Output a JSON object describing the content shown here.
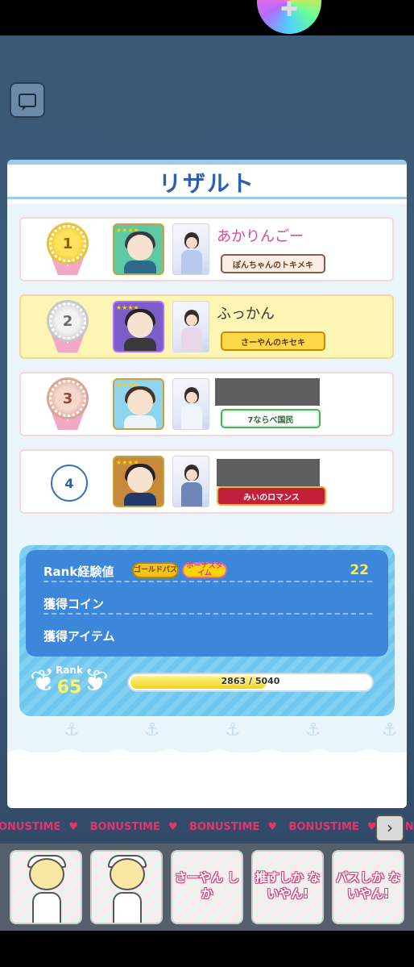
{
  "modal": {
    "title": "リザルト"
  },
  "results": [
    {
      "rank": "1",
      "name": "あかりんごー",
      "badge": "ぽんちゃんのトキメキ",
      "name_hidden": false
    },
    {
      "rank": "2",
      "name": "ふっかん",
      "badge": "さーやんのキセキ",
      "name_hidden": false
    },
    {
      "rank": "3",
      "name": "",
      "badge": "7ならべ国民",
      "name_hidden": true
    },
    {
      "rank": "4",
      "name": "",
      "badge": "みいのロマンス",
      "name_hidden": true
    }
  ],
  "rewards": {
    "rank_exp_label": "Rank経験値",
    "gold_pass_label": "ゴールドパス",
    "bonus_time_label": "ボーナスタイム",
    "rank_exp_value": "22",
    "coin_label": "獲得コイン",
    "item_label": "獲得アイテム"
  },
  "rank": {
    "label": "Rank",
    "value": "65",
    "progress_text": "2863 / 5040",
    "progress_fraction": 0.568
  },
  "bonus_strip": {
    "items": [
      "BONUSTIME",
      "BONUSTIME",
      "BONUSTIME",
      "BONUSTIME",
      "BONUSTIME"
    ],
    "first_partial": "ONUSTIME"
  },
  "bottom_cards": [
    {
      "label": ""
    },
    {
      "label": ""
    },
    {
      "label": "さーやん しか"
    },
    {
      "label": "推すしか ないやん!"
    },
    {
      "label": "パスしか ないやん!"
    }
  ]
}
